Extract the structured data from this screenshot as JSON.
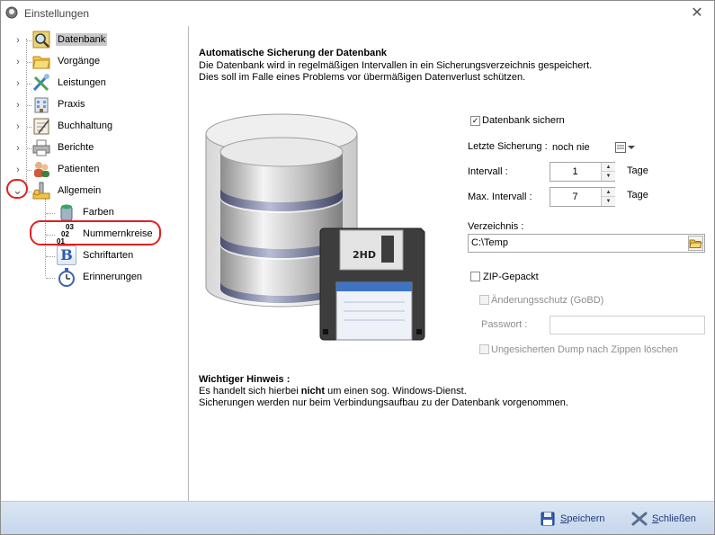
{
  "window": {
    "title": "Einstellungen"
  },
  "tree": {
    "items": [
      {
        "label": "Datenbank"
      },
      {
        "label": "Vorgänge"
      },
      {
        "label": "Leistungen"
      },
      {
        "label": "Praxis"
      },
      {
        "label": "Buchhaltung"
      },
      {
        "label": "Berichte"
      },
      {
        "label": "Patienten"
      },
      {
        "label": "Allgemein"
      },
      {
        "label": "Farben"
      },
      {
        "label": "Nummernkreise"
      },
      {
        "label": "Schriftarten"
      },
      {
        "label": "Erinnerungen"
      }
    ],
    "numbers_icon": {
      "l1": "03",
      "l2": "02",
      "l3": "01"
    },
    "bold_icon": "B"
  },
  "content": {
    "heading": "Automatische Sicherung der Datenbank",
    "desc_line1": "Die Datenbank wird in regelmäßigen Intervallen in ein Sicherungsverzeichnis gespeichert.",
    "desc_line2": "Dies soll im Falle eines Problems vor übermäßigen Datenverlust schützen.",
    "floppy_label": "2HD",
    "backup_checkbox": {
      "label": "Datenbank sichern",
      "checked": true
    },
    "last_backup": {
      "label": "Letzte Sicherung :",
      "value": "noch nie"
    },
    "interval": {
      "label": "Intervall :",
      "value": "1",
      "unit": "Tage"
    },
    "max_interval": {
      "label": "Max. Intervall :",
      "value": "7",
      "unit": "Tage"
    },
    "directory": {
      "label": "Verzeichnis :",
      "value": "C:\\Temp"
    },
    "zip": {
      "label": "ZIP-Gepackt",
      "checked": false
    },
    "change_protection": {
      "label": "Änderungsschutz (GoBD)",
      "checked": false
    },
    "password": {
      "label": "Passwort :",
      "value": ""
    },
    "delete_dump": {
      "label": "Ungesicherten Dump nach Zippen löschen",
      "checked": false
    },
    "notice_title": "Wichtiger Hinweis :",
    "notice_line1_pre": "Es handelt sich hierbei ",
    "notice_line1_bold": "nicht",
    "notice_line1_post": " um einen sog. Windows-Dienst.",
    "notice_line2": "Sicherungen werden nur beim Verbindungsaufbau zu der Datenbank vorgenommen."
  },
  "footer": {
    "save": {
      "accel": "S",
      "rest": "peichern"
    },
    "close": {
      "accel": "S",
      "rest": "chließen"
    }
  },
  "colors": {
    "highlight": "#e02020",
    "footer": "#c6d6ec",
    "link": "#1d3a7a"
  }
}
